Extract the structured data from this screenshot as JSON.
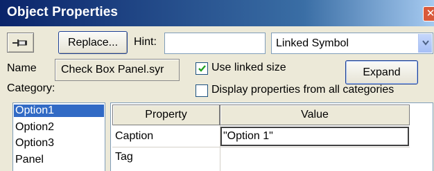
{
  "window": {
    "title": "Object Properties",
    "close_glyph": "✕"
  },
  "toolbar": {
    "pin_icon": "pin-icon",
    "replace_label": "Replace...",
    "hint_label": "Hint:",
    "hint_value": "",
    "symbol_type": {
      "selected": "Linked Symbol"
    }
  },
  "info": {
    "name_label": "Name",
    "name_value": "Check Box Panel.syr",
    "use_linked_size": {
      "label": "Use linked size",
      "checked": true
    },
    "display_all": {
      "label": "Display properties from all categories",
      "checked": false
    },
    "expand_label": "Expand",
    "category_label": "Category:"
  },
  "categories": [
    {
      "label": "Option1",
      "selected": true
    },
    {
      "label": "Option2",
      "selected": false
    },
    {
      "label": "Option3",
      "selected": false
    },
    {
      "label": "Panel",
      "selected": false
    }
  ],
  "property_grid": {
    "columns": [
      "Property",
      "Value"
    ],
    "rows": [
      {
        "property": "Caption",
        "value": "\"Option 1\""
      },
      {
        "property": "Tag",
        "value": ""
      }
    ]
  },
  "colors": {
    "title_gradient_start": "#0a246a",
    "selection": "#316ac5",
    "face": "#ece9d8"
  }
}
